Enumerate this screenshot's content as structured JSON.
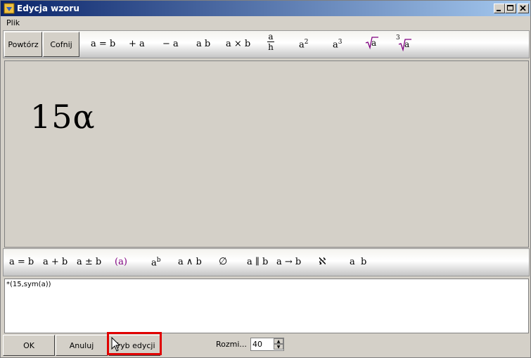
{
  "window": {
    "title": "Edycja wzoru",
    "minimize_label": "_",
    "maximize_label": "□",
    "close_label": "×"
  },
  "menu": {
    "file": "Plik"
  },
  "top_toolbar": {
    "redo_label": "Powtórz",
    "undo_label": "Cofnij",
    "symbols": {
      "equals": "a = b",
      "plus": "+ a",
      "minus": "− a",
      "juxtapose": "a b",
      "times": "a × b",
      "frac_num": "a",
      "frac_den": "h",
      "square_base": "a",
      "square_exp": "2",
      "cube_base": "a",
      "cube_exp": "3",
      "sqrt_arg": "a",
      "cbrt_index": "3",
      "cbrt_arg": "a"
    }
  },
  "canvas": {
    "formula": "15α"
  },
  "bottom_toolbar": {
    "symbols": {
      "equals": "a = b",
      "plus": "a + b",
      "plusminus": "a ± b",
      "parens": "(a)",
      "power_base": "a",
      "power_exp": "b",
      "wedge": "a ∧ b",
      "emptyset": "∅",
      "parallel": "a ∥ b",
      "arrow": "a → b",
      "aleph": "ℵ",
      "space": "a  b"
    }
  },
  "editor": {
    "expression": "*(15,sym(a))"
  },
  "bottom_bar": {
    "ok_label": "OK",
    "cancel_label": "Anuluj",
    "edit_mode_label": "Tryb edycji",
    "size_label": "Rozmi...",
    "size_value": "40"
  },
  "colors": {
    "accent": "#800080",
    "highlight": "#e00000",
    "titlebar_start": "#0a246a",
    "titlebar_end": "#a6caf0"
  }
}
